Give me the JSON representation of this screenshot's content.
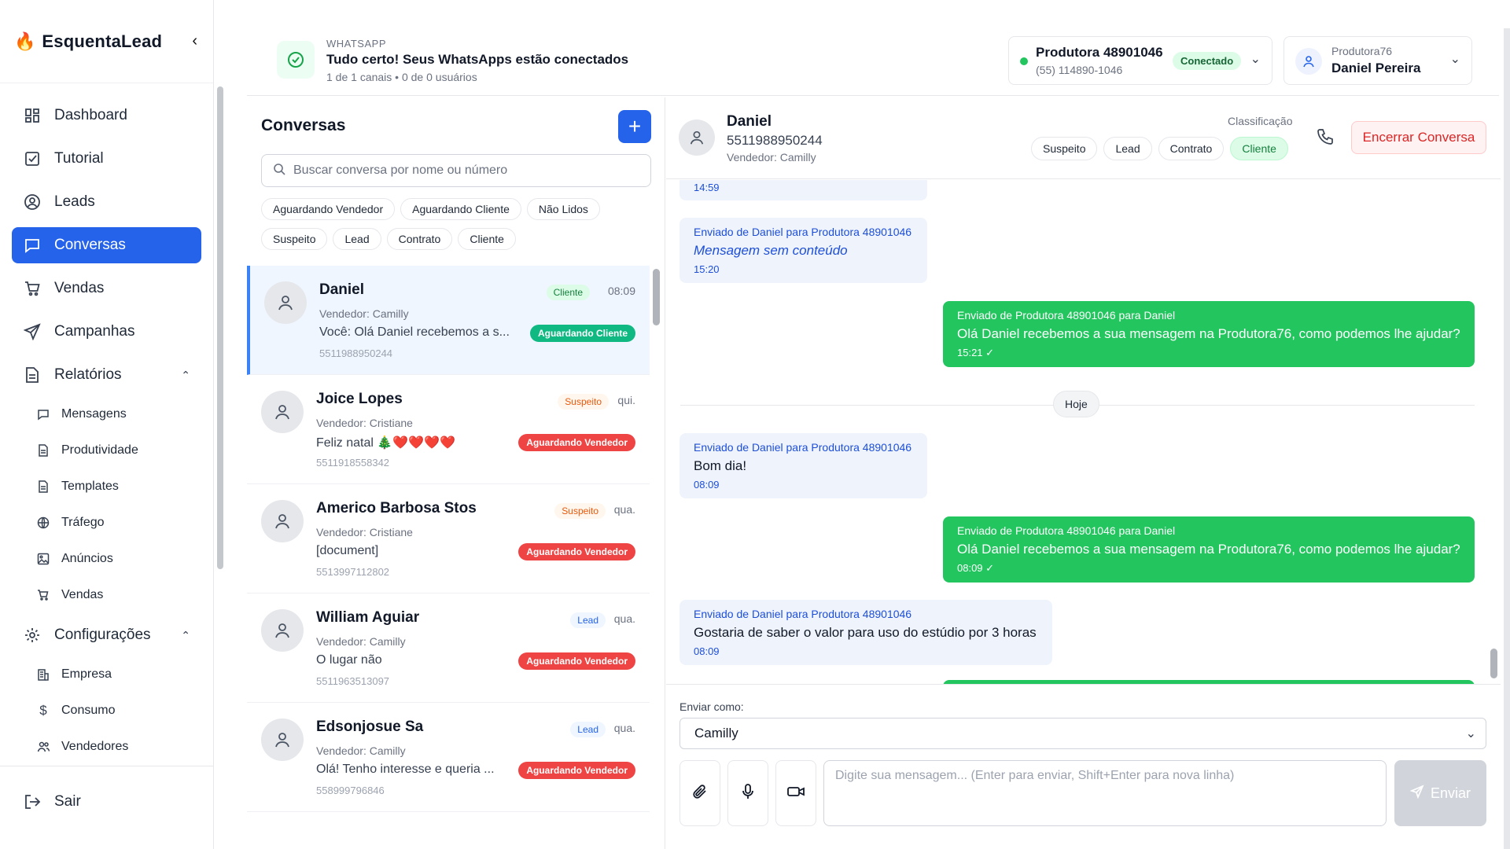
{
  "brand": {
    "name": "EsquentaLead",
    "collapse": "‹"
  },
  "nav": {
    "dashboard": "Dashboard",
    "tutorial": "Tutorial",
    "leads": "Leads",
    "conversas": "Conversas",
    "vendas": "Vendas",
    "campanhas": "Campanhas",
    "relatorios": "Relatórios",
    "relatorios_sub": [
      "Mensagens",
      "Produtividade",
      "Templates",
      "Tráfego",
      "Anúncios",
      "Vendas"
    ],
    "configuracoes": "Configurações",
    "config_sub": [
      "Empresa",
      "Consumo",
      "Vendedores"
    ],
    "sair": "Sair"
  },
  "header": {
    "label": "WHATSAPP",
    "title": "Tudo certo! Seus WhatsApps estão conectados",
    "subtitle": "1 de 1 canais • 0 de 0 usuários",
    "connection": {
      "name": "Produtora 48901046",
      "number": "(55) 114890-1046",
      "status": "Conectado"
    },
    "user": {
      "org": "Produtora76",
      "name": "Daniel Pereira"
    }
  },
  "list": {
    "title": "Conversas",
    "add": "+",
    "search_placeholder": "Buscar conversa por nome ou número",
    "filters": [
      "Aguardando Vendedor",
      "Aguardando Cliente",
      "Não Lidos",
      "Suspeito",
      "Lead",
      "Contrato",
      "Cliente"
    ],
    "conversations": [
      {
        "name": "Daniel",
        "vendor": "Vendedor: Camilly",
        "message": "Você: Olá Daniel recebemos a s...",
        "phone": "5511988950244",
        "tag": "Cliente",
        "time": "08:09",
        "status": "Aguardando Cliente"
      },
      {
        "name": "Joice Lopes",
        "vendor": "Vendedor: Cristiane",
        "message": "Feliz natal 🎄❤️❤️❤️❤️",
        "phone": "5511918558342",
        "tag": "Suspeito",
        "time": "qui.",
        "status": "Aguardando Vendedor"
      },
      {
        "name": "Americo Barbosa Stos",
        "vendor": "Vendedor: Cristiane",
        "message": "[document]",
        "phone": "5513997112802",
        "tag": "Suspeito",
        "time": "qua.",
        "status": "Aguardando Vendedor"
      },
      {
        "name": "William Aguiar",
        "vendor": "Vendedor: Camilly",
        "message": "O lugar não",
        "phone": "5511963513097",
        "tag": "Lead",
        "time": "qua.",
        "status": "Aguardando Vendedor"
      },
      {
        "name": "Edsonjosue Sa",
        "vendor": "Vendedor: Camilly",
        "message": "Olá! Tenho interesse e queria ...",
        "phone": "558999796846",
        "tag": "Lead",
        "time": "qua.",
        "status": "Aguardando Vendedor"
      }
    ]
  },
  "chat": {
    "name": "Daniel",
    "number": "5511988950244",
    "vendor": "Vendedor: Camilly",
    "classification_label": "Classificação",
    "classifications": [
      "Suspeito",
      "Lead",
      "Contrato",
      "Cliente"
    ],
    "active_classification": "Cliente",
    "end_button": "Encerrar Conversa",
    "messages": [
      {
        "time": "14:59"
      },
      {
        "header": "Enviado de Daniel para Produtora 48901046",
        "body": "Mensagem sem conteúdo",
        "time": "15:20"
      },
      {
        "header": "Enviado de Produtora 48901046 para Daniel",
        "body": "Olá Daniel recebemos a sua mensagem na Produtora76, como podemos lhe ajudar?",
        "time": "15:21 ✓"
      },
      {
        "header": "Enviado de Daniel para Produtora 48901046",
        "body": "Bom dia!",
        "time": "08:09"
      },
      {
        "header": "Enviado de Produtora 48901046 para Daniel",
        "body": "Olá Daniel recebemos a sua mensagem na Produtora76, como podemos lhe ajudar?",
        "time": "08:09 ✓"
      },
      {
        "header": "Enviado de Daniel para Produtora 48901046",
        "body": "Gostaria de saber o valor para uso do estúdio por 3 horas",
        "time": "08:09"
      }
    ],
    "day_separator": "Hoje",
    "send_as_label": "Enviar como:",
    "send_as_value": "Camilly",
    "input_placeholder": "Digite sua mensagem... (Enter para enviar, Shift+Enter para nova linha)",
    "send_button": "Enviar"
  },
  "colors": {
    "accent": "#2563eb",
    "green": "#22c55e",
    "danger": "#ef4444"
  }
}
